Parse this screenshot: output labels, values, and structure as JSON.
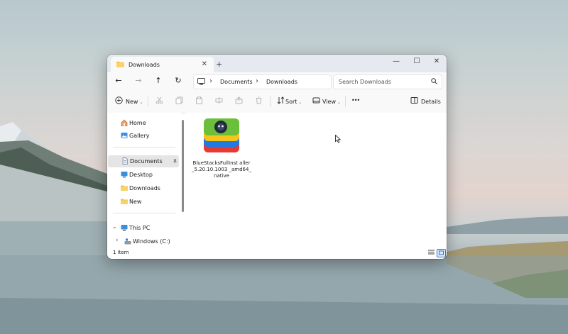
{
  "window": {
    "tab_title": "Downloads",
    "tab_close": "✕",
    "new_tab": "+",
    "controls": {
      "minimize": "—",
      "maximize": "☐",
      "close": "✕"
    }
  },
  "nav": {
    "back": "←",
    "forward": "→",
    "up": "↑",
    "refresh": "↻",
    "breadcrumb_sep": "›",
    "breadcrumbs": [
      "Documents",
      "Downloads"
    ],
    "search_placeholder": "Search Downloads"
  },
  "toolbar": {
    "new_label": "New",
    "sort_label": "Sort",
    "view_label": "View",
    "more_label": "•••",
    "details_label": "Details",
    "caret": "⌄"
  },
  "sidebar": {
    "quick": [
      {
        "label": "Home",
        "icon": "home-icon"
      },
      {
        "label": "Gallery",
        "icon": "gallery-icon"
      }
    ],
    "pinned": [
      {
        "label": "Documents",
        "icon": "documents-icon",
        "selected": true
      },
      {
        "label": "Desktop",
        "icon": "desktop-icon"
      },
      {
        "label": "Downloads",
        "icon": "folder-icon"
      },
      {
        "label": "New",
        "icon": "folder-icon"
      }
    ],
    "tree": [
      {
        "label": "This PC",
        "icon": "pc-icon",
        "chevron": "⌄"
      },
      {
        "label": "Windows (C:)",
        "icon": "drive-icon",
        "chevron": "›"
      }
    ]
  },
  "files": [
    {
      "name": "BlueStacksFullInst aller_5.20.10.1003 _amd64_native",
      "icon": "bluestacks-icon"
    }
  ],
  "status": {
    "count": "1 item"
  },
  "colors": {
    "accent": "#2b73c8",
    "folder": "#f3c24b"
  }
}
